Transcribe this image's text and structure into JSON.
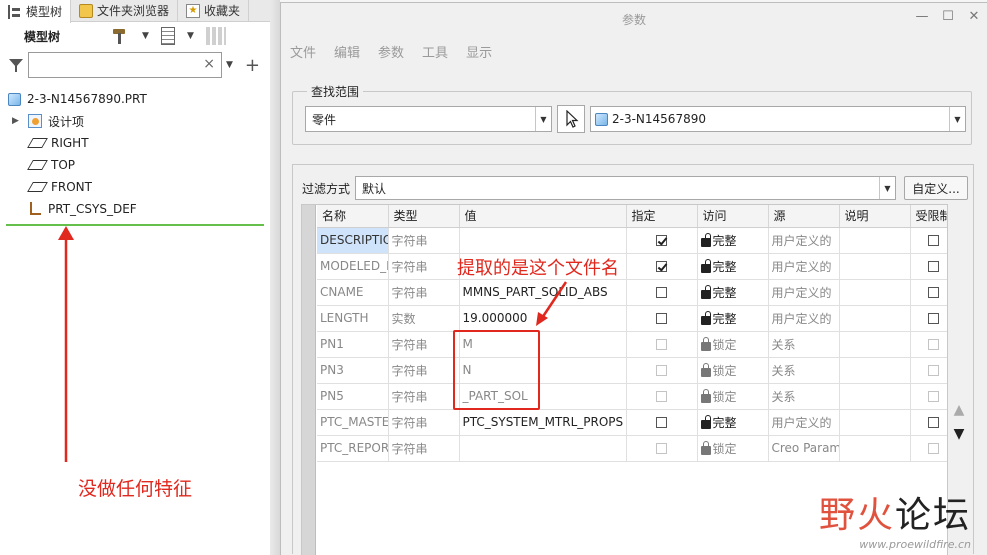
{
  "left_panel": {
    "tabs": [
      {
        "label": "模型树",
        "icon": "model-tree-icon"
      },
      {
        "label": "文件夹浏览器",
        "icon": "folder-icon"
      },
      {
        "label": "收藏夹",
        "icon": "favorites-icon"
      }
    ],
    "tree_title": "模型树",
    "search_value": "",
    "tree": {
      "root": "2-3-N14567890.PRT",
      "items": [
        {
          "label": "设计项",
          "icon": "design-items-icon",
          "expandable": true
        },
        {
          "label": "RIGHT",
          "icon": "datum-plane-icon"
        },
        {
          "label": "TOP",
          "icon": "datum-plane-icon"
        },
        {
          "label": "FRONT",
          "icon": "datum-plane-icon"
        },
        {
          "label": "PRT_CSYS_DEF",
          "icon": "coordinate-system-icon"
        }
      ]
    },
    "annotation": "没做任何特征"
  },
  "dialog": {
    "title": "参数",
    "menu": [
      "文件",
      "编辑",
      "参数",
      "工具",
      "显示"
    ],
    "scope": {
      "legend": "查找范围",
      "type_value": "零件",
      "object_value": "2-3-N14567890"
    },
    "filter": {
      "label": "过滤方式",
      "value": "默认",
      "customize_button": "自定义..."
    },
    "table": {
      "headers": [
        "名称",
        "类型",
        "值",
        "指定",
        "访问",
        "源",
        "说明",
        "受限制"
      ],
      "rows": [
        {
          "name": "DESCRIPTION",
          "type": "字符串",
          "value": "",
          "designated": true,
          "access": "完整",
          "source": "用户定义的",
          "locked": false
        },
        {
          "name": "MODELED_BY",
          "type": "字符串",
          "value": "",
          "designated": true,
          "access": "完整",
          "source": "用户定义的",
          "locked": false
        },
        {
          "name": "CNAME",
          "type": "字符串",
          "value": "MMNS_PART_SOLID_ABS",
          "designated": false,
          "access": "完整",
          "source": "用户定义的",
          "locked": false
        },
        {
          "name": "LENGTH",
          "type": "实数",
          "value": "19.000000",
          "designated": false,
          "access": "完整",
          "source": "用户定义的",
          "locked": false
        },
        {
          "name": "PN1",
          "type": "字符串",
          "value": "M",
          "designated": false,
          "access": "锁定",
          "source": "关系",
          "locked": true
        },
        {
          "name": "PN3",
          "type": "字符串",
          "value": "N",
          "designated": false,
          "access": "锁定",
          "source": "关系",
          "locked": true
        },
        {
          "name": "PN5",
          "type": "字符串",
          "value": "_PART_SOL",
          "designated": false,
          "access": "锁定",
          "source": "关系",
          "locked": true
        },
        {
          "name": "PTC_MASTER_MATERIAL",
          "type": "字符串",
          "value": "PTC_SYSTEM_MTRL_PROPS",
          "designated": false,
          "access": "完整",
          "source": "用户定义的",
          "locked": false
        },
        {
          "name": "PTC_REPORT",
          "type": "字符串",
          "value": "",
          "designated": false,
          "access": "锁定",
          "source": "Creo Parametric",
          "locked": true
        }
      ]
    },
    "annotation": "提取的是这个文件名"
  },
  "watermark": {
    "brand_a": "野火",
    "brand_b": "论坛",
    "url": "www.proewildfire.cn"
  },
  "colors": {
    "annotation_red": "#e0281e",
    "highlight_blue": "#cfe4fb",
    "insert_green": "#64c04a"
  }
}
